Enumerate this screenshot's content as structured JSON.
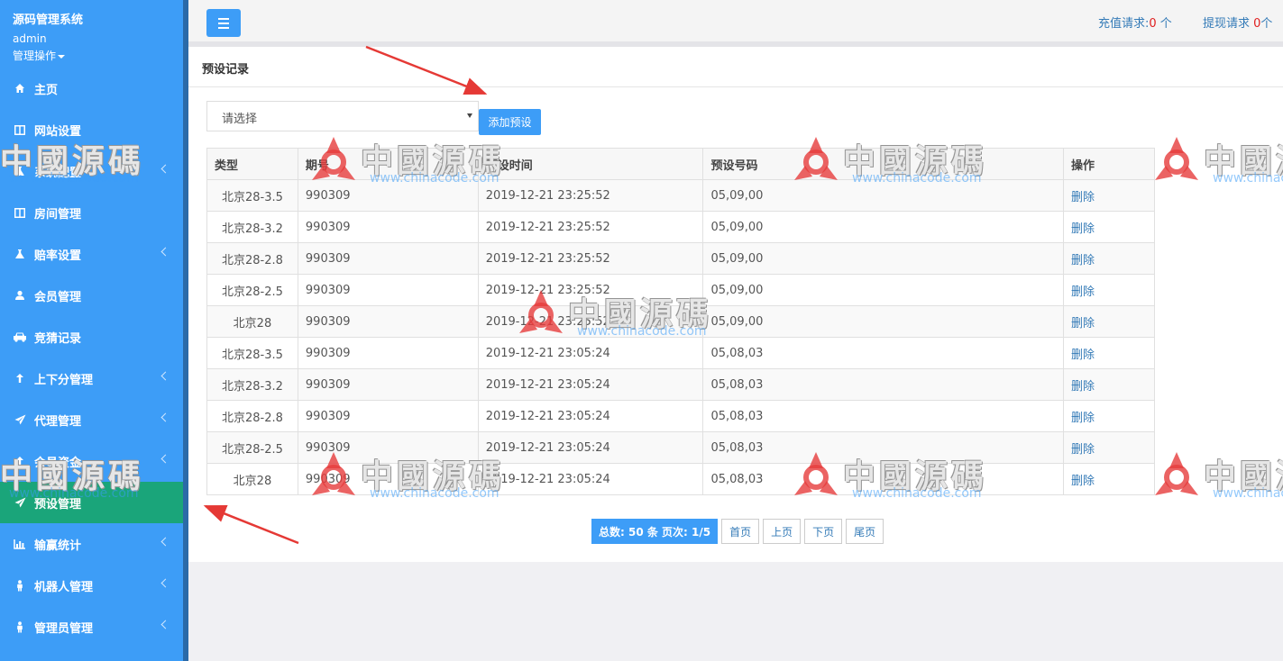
{
  "sidebar": {
    "brand": "源码管理系统",
    "user": "admin",
    "manage": "管理操作",
    "items": [
      {
        "label": "主页",
        "icon": "home-icon",
        "has_sub": false,
        "active": false
      },
      {
        "label": "网站设置",
        "icon": "columns-icon",
        "has_sub": false,
        "active": false
      },
      {
        "label": "系统配置",
        "icon": "flask-icon",
        "has_sub": true,
        "active": false
      },
      {
        "label": "房间管理",
        "icon": "columns-icon",
        "has_sub": false,
        "active": false
      },
      {
        "label": "赔率设置",
        "icon": "flask-icon",
        "has_sub": true,
        "active": false
      },
      {
        "label": "会员管理",
        "icon": "user-icon",
        "has_sub": false,
        "active": false
      },
      {
        "label": "竞猜记录",
        "icon": "car-icon",
        "has_sub": false,
        "active": false
      },
      {
        "label": "上下分管理",
        "icon": "arrow-up-icon",
        "has_sub": true,
        "active": false
      },
      {
        "label": "代理管理",
        "icon": "paper-plane-icon",
        "has_sub": true,
        "active": false
      },
      {
        "label": "会员资金",
        "icon": "arrow-up-icon",
        "has_sub": true,
        "active": false
      },
      {
        "label": "预设管理",
        "icon": "paper-plane-icon",
        "has_sub": false,
        "active": true
      },
      {
        "label": "输赢统计",
        "icon": "bar-chart-icon",
        "has_sub": true,
        "active": false
      },
      {
        "label": "机器人管理",
        "icon": "person-icon",
        "has_sub": true,
        "active": false
      },
      {
        "label": "管理员管理",
        "icon": "person-icon",
        "has_sub": true,
        "active": false
      }
    ]
  },
  "header": {
    "recharge_label": "充值请求:",
    "recharge_count": "0",
    "recharge_unit": " 个",
    "withdraw_label": "提现请求 ",
    "withdraw_count": "0",
    "withdraw_unit": "个"
  },
  "panel": {
    "title": "预设记录",
    "select_placeholder": "请选择",
    "add_button": "添加预设"
  },
  "table": {
    "headers": [
      "类型",
      "期号",
      "预设时间",
      "预设号码",
      "操作"
    ],
    "delete_label": "删除",
    "rows": [
      [
        "北京28-3.5",
        "990309",
        "2019-12-21 23:25:52",
        "05,09,00"
      ],
      [
        "北京28-3.2",
        "990309",
        "2019-12-21 23:25:52",
        "05,09,00"
      ],
      [
        "北京28-2.8",
        "990309",
        "2019-12-21 23:25:52",
        "05,09,00"
      ],
      [
        "北京28-2.5",
        "990309",
        "2019-12-21 23:25:52",
        "05,09,00"
      ],
      [
        "北京28",
        "990309",
        "2019-12-21 23:25:52",
        "05,09,00"
      ],
      [
        "北京28-3.5",
        "990309",
        "2019-12-21 23:05:24",
        "05,08,03"
      ],
      [
        "北京28-3.2",
        "990309",
        "2019-12-21 23:05:24",
        "05,08,03"
      ],
      [
        "北京28-2.8",
        "990309",
        "2019-12-21 23:05:24",
        "05,08,03"
      ],
      [
        "北京28-2.5",
        "990309",
        "2019-12-21 23:05:24",
        "05,08,03"
      ],
      [
        "北京28",
        "990309",
        "2019-12-21 23:05:24",
        "05,08,03"
      ]
    ]
  },
  "pager": {
    "summary": "总数: 50 条 页次: 1/5",
    "first": "首页",
    "prev": "上页",
    "next": "下页",
    "last": "尾页"
  },
  "watermark": {
    "text": "中國源碼",
    "url": "www.chinacode.com"
  },
  "colors": {
    "sidebar": "#3d9df7",
    "active": "#1aa57a",
    "link": "#337ab7",
    "alert": "#e02020"
  }
}
